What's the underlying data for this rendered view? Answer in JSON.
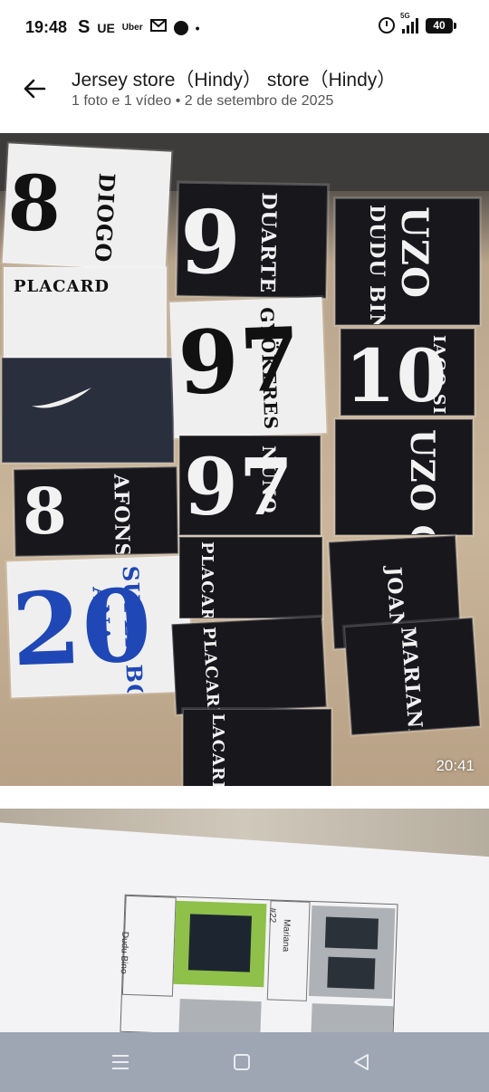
{
  "status": {
    "time": "19:48",
    "icons": [
      "S",
      "UE",
      "Uber",
      "gmail-icon",
      "burger-king-icon",
      "•"
    ],
    "network": "5G",
    "battery": "40"
  },
  "header": {
    "title": "Jersey store（Hindy） store（Hindy）",
    "subtitle": "1 foto e 1 vídeo  •  2 de setembro de 2025"
  },
  "media": {
    "video_duration": "20:41",
    "jersey_names": [
      "DIOGO",
      "DUARTE",
      "DUDU BINO",
      "UZO",
      "GYÖKERES",
      "IAGO SILVA",
      "NUNO",
      "UZO CAMPOS",
      "AFONSO",
      "SUPER BOCK",
      "ANA",
      "JOANA",
      "MARIANA",
      "PLACARD",
      "LACARD"
    ],
    "jersey_numbers": [
      "8",
      "9",
      "10",
      "97",
      "20"
    ],
    "sheet_labels": [
      "Dudu Bino",
      "#22",
      "Mariana"
    ]
  },
  "nav": {
    "recent_icon": "recent-apps-icon",
    "home_icon": "home-icon",
    "back_icon": "back-icon"
  },
  "colors": {
    "header_bg": "#ffffff",
    "nav_bg": "#9ea6b3",
    "status_text": "#111111"
  }
}
